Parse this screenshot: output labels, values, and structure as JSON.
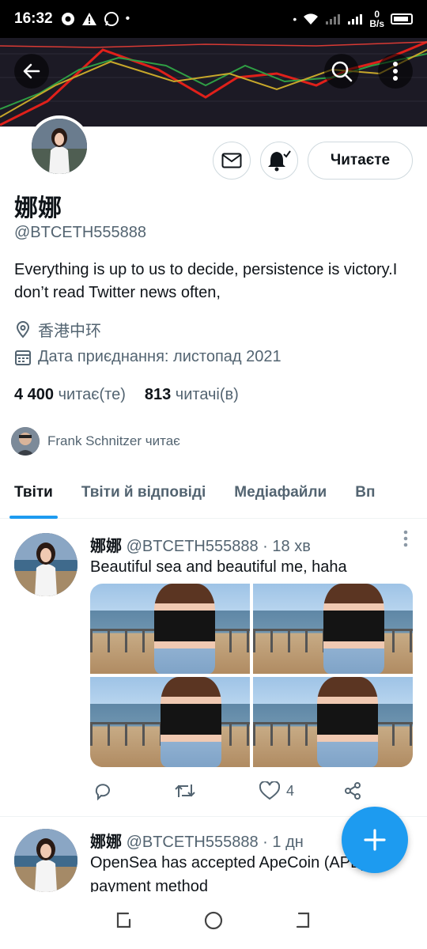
{
  "status_bar": {
    "time": "16:32",
    "net_speed_value": "0",
    "net_speed_unit": "B/s"
  },
  "profile": {
    "display_name": "娜娜",
    "handle": "@BTCETH555888",
    "bio": "Everything is up to us to decide, persistence is victory.I don’t read Twitter news often,",
    "location": "香港中环",
    "joined": "Дата приєднання: листопад 2021",
    "following_count": "4 400",
    "following_label": "читає(те)",
    "followers_count": "813",
    "followers_label": "читачі(в)",
    "followed_by": "Frank Schnitzer читає",
    "follow_button_label": "Читаєте"
  },
  "tabs": [
    {
      "label": "Твіти",
      "active": true
    },
    {
      "label": "Твіти й відповіді",
      "active": false
    },
    {
      "label": "Медіафайли",
      "active": false
    },
    {
      "label": "Вп",
      "active": false
    }
  ],
  "tweets": [
    {
      "name": "娜娜",
      "handle": "@BTCETH555888",
      "time": "· 18 хв",
      "text": "Beautiful sea and beautiful me, haha",
      "likes": "4"
    },
    {
      "name": "娜娜",
      "handle": "@BTCETH555888",
      "time": "· 1 дн",
      "text": "OpenSea has accepted ApeCoin (APE) as payment method"
    }
  ],
  "colors": {
    "accent": "#1d9bf0",
    "secondary_text": "#536471",
    "banner": "#1c1a25"
  },
  "icons": [
    "back-arrow-icon",
    "search-icon",
    "more-vertical-icon",
    "mail-icon",
    "bell-icon",
    "location-icon",
    "calendar-icon",
    "reply-icon",
    "retweet-icon",
    "like-icon",
    "share-icon",
    "plus-icon"
  ]
}
